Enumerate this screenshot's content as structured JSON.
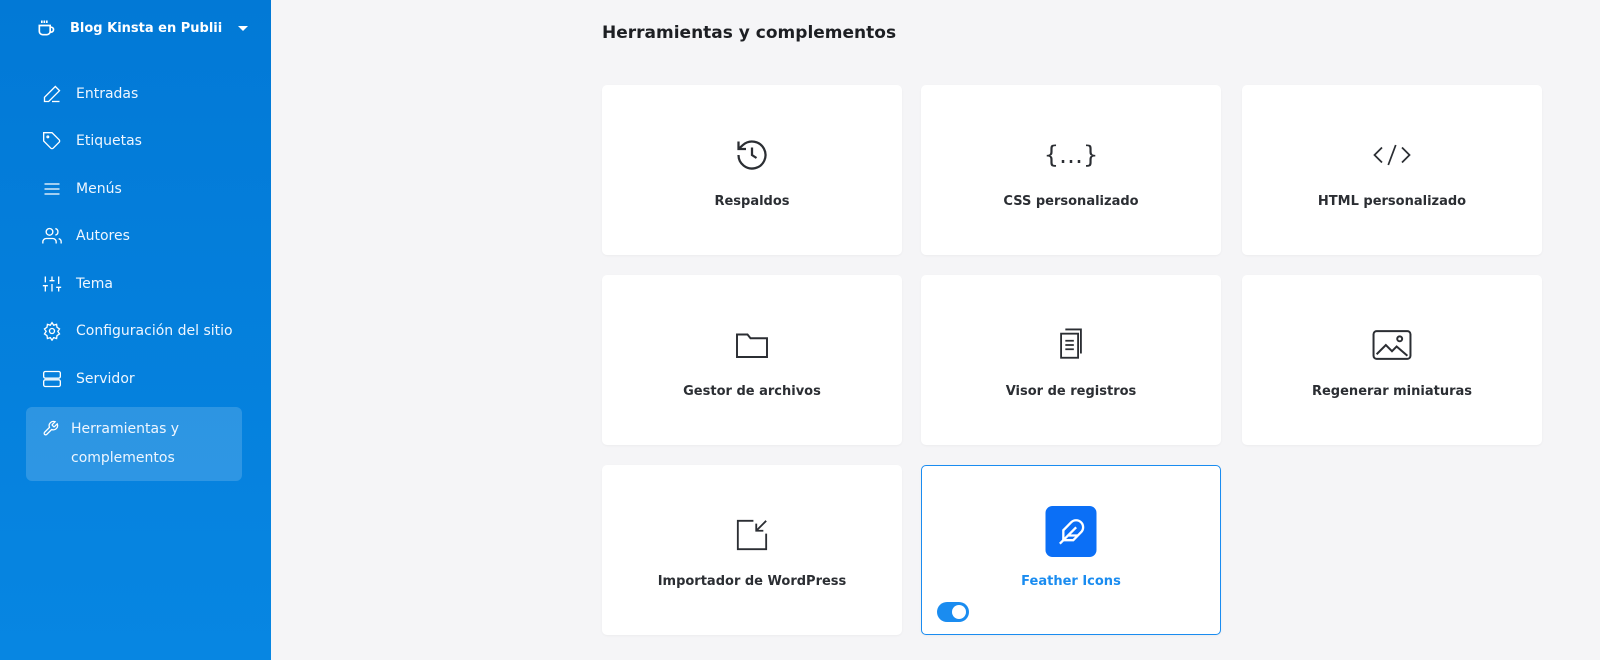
{
  "sidebar": {
    "site_name": "Blog Kinsta en Publii",
    "items": [
      {
        "label": "Entradas",
        "icon": "pen-icon"
      },
      {
        "label": "Etiquetas",
        "icon": "tag-icon"
      },
      {
        "label": "Menús",
        "icon": "menu-icon"
      },
      {
        "label": "Autores",
        "icon": "users-icon"
      },
      {
        "label": "Tema",
        "icon": "sliders-icon"
      },
      {
        "label": "Configuración del sitio",
        "icon": "gear-icon"
      },
      {
        "label": "Servidor",
        "icon": "server-icon"
      },
      {
        "label": "Herramientas y complementos",
        "icon": "wrench-icon",
        "active": true
      }
    ]
  },
  "main": {
    "title": "Herramientas y complementos",
    "cards": [
      {
        "label": "Respaldos",
        "icon": "history-icon"
      },
      {
        "label": "CSS personalizado",
        "icon": "braces-icon"
      },
      {
        "label": "HTML personalizado",
        "icon": "code-icon"
      },
      {
        "label": "Gestor de archivos",
        "icon": "folder-icon"
      },
      {
        "label": "Visor de registros",
        "icon": "document-icon"
      },
      {
        "label": "Regenerar miniaturas",
        "icon": "image-icon"
      },
      {
        "label": "Importador de WordPress",
        "icon": "import-icon"
      },
      {
        "label": "Feather Icons",
        "icon": "feather-icon",
        "enabled": true
      }
    ]
  },
  "colors": {
    "accent": "#1a8cf0",
    "sidebar": "#0279d6"
  }
}
